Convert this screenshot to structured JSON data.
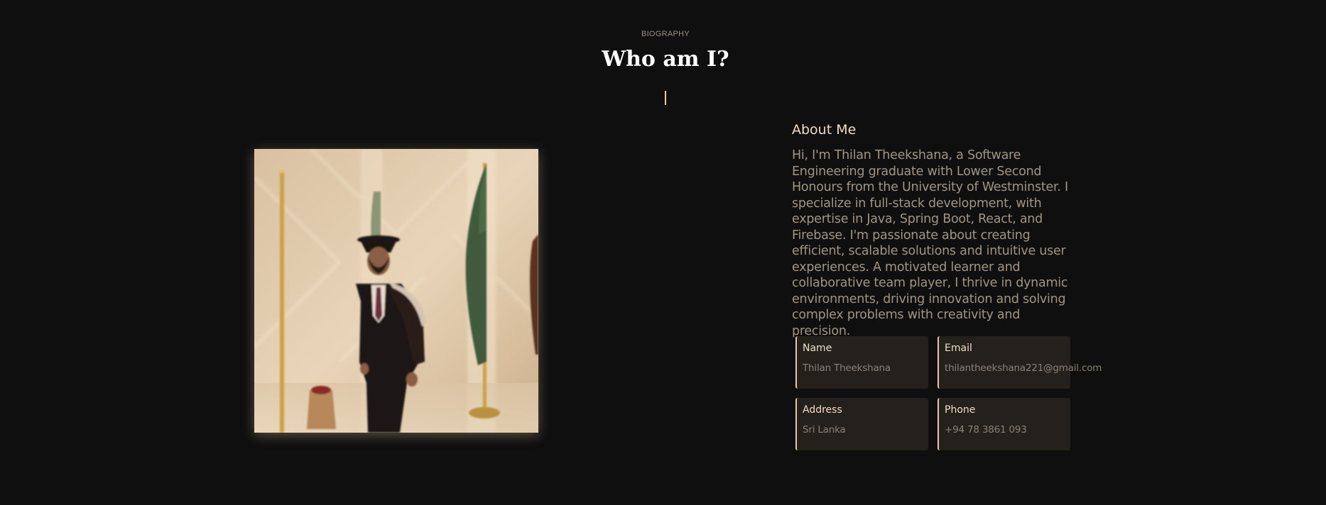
{
  "section": {
    "eyebrow": "BIOGRAPHY",
    "title": "Who am I?"
  },
  "profile_photo": {
    "alt": "Graduate in academic gown and cap"
  },
  "about": {
    "heading": "About Me",
    "body": "Hi, I'm Thilan Theekshana, a Software Engineering graduate with Lower Second Honours from the University of Westminster. I specialize in full-stack development, with expertise in Java, Spring Boot, React, and Firebase. I'm passionate about creating efficient, scalable solutions and intuitive user experiences. A motivated learner and collaborative team player, I thrive in dynamic environments, driving innovation and solving complex problems with creativity and precision."
  },
  "info_cards": [
    {
      "label": "Name",
      "value": "Thilan Theekshana"
    },
    {
      "label": "Email",
      "value": "thilantheekshana221@gmail.com"
    },
    {
      "label": "Address",
      "value": "Sri Lanka"
    },
    {
      "label": "Phone",
      "value": "+94 78 3861 093"
    }
  ],
  "colors": {
    "background": "#0f0f10",
    "accent": "#e8c9a8",
    "card_bg": "#24211d"
  }
}
